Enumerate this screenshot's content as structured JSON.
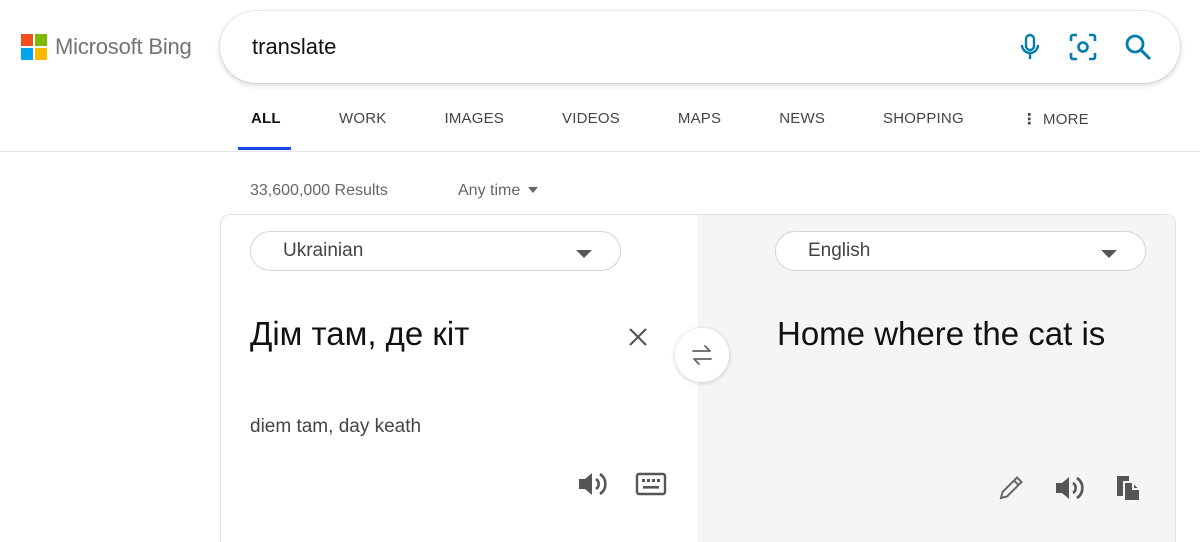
{
  "brand": {
    "logo_text": "Microsoft Bing",
    "colors": [
      "#f25022",
      "#7fba00",
      "#00a4ef",
      "#ffb900"
    ]
  },
  "search": {
    "query": "translate",
    "icons": [
      "microphone-icon",
      "visual-search-icon",
      "search-icon"
    ],
    "accent": "#007daa"
  },
  "tabs": [
    {
      "label": "ALL",
      "active": true
    },
    {
      "label": "WORK"
    },
    {
      "label": "IMAGES"
    },
    {
      "label": "VIDEOS"
    },
    {
      "label": "MAPS"
    },
    {
      "label": "NEWS"
    },
    {
      "label": "SHOPPING"
    },
    {
      "label": "MORE"
    }
  ],
  "results": {
    "count": "33,600,000 Results",
    "time_filter": "Any time"
  },
  "translator": {
    "source_language": "Ukrainian",
    "target_language": "English",
    "source_text": "Дім там, де кіт",
    "transliteration": "diem tam, day keath",
    "target_text": "Home where the cat is",
    "source_tools": [
      "speaker-icon",
      "keyboard-icon"
    ],
    "target_tools": [
      "pencil-icon",
      "speaker-icon",
      "copy-icon"
    ]
  }
}
